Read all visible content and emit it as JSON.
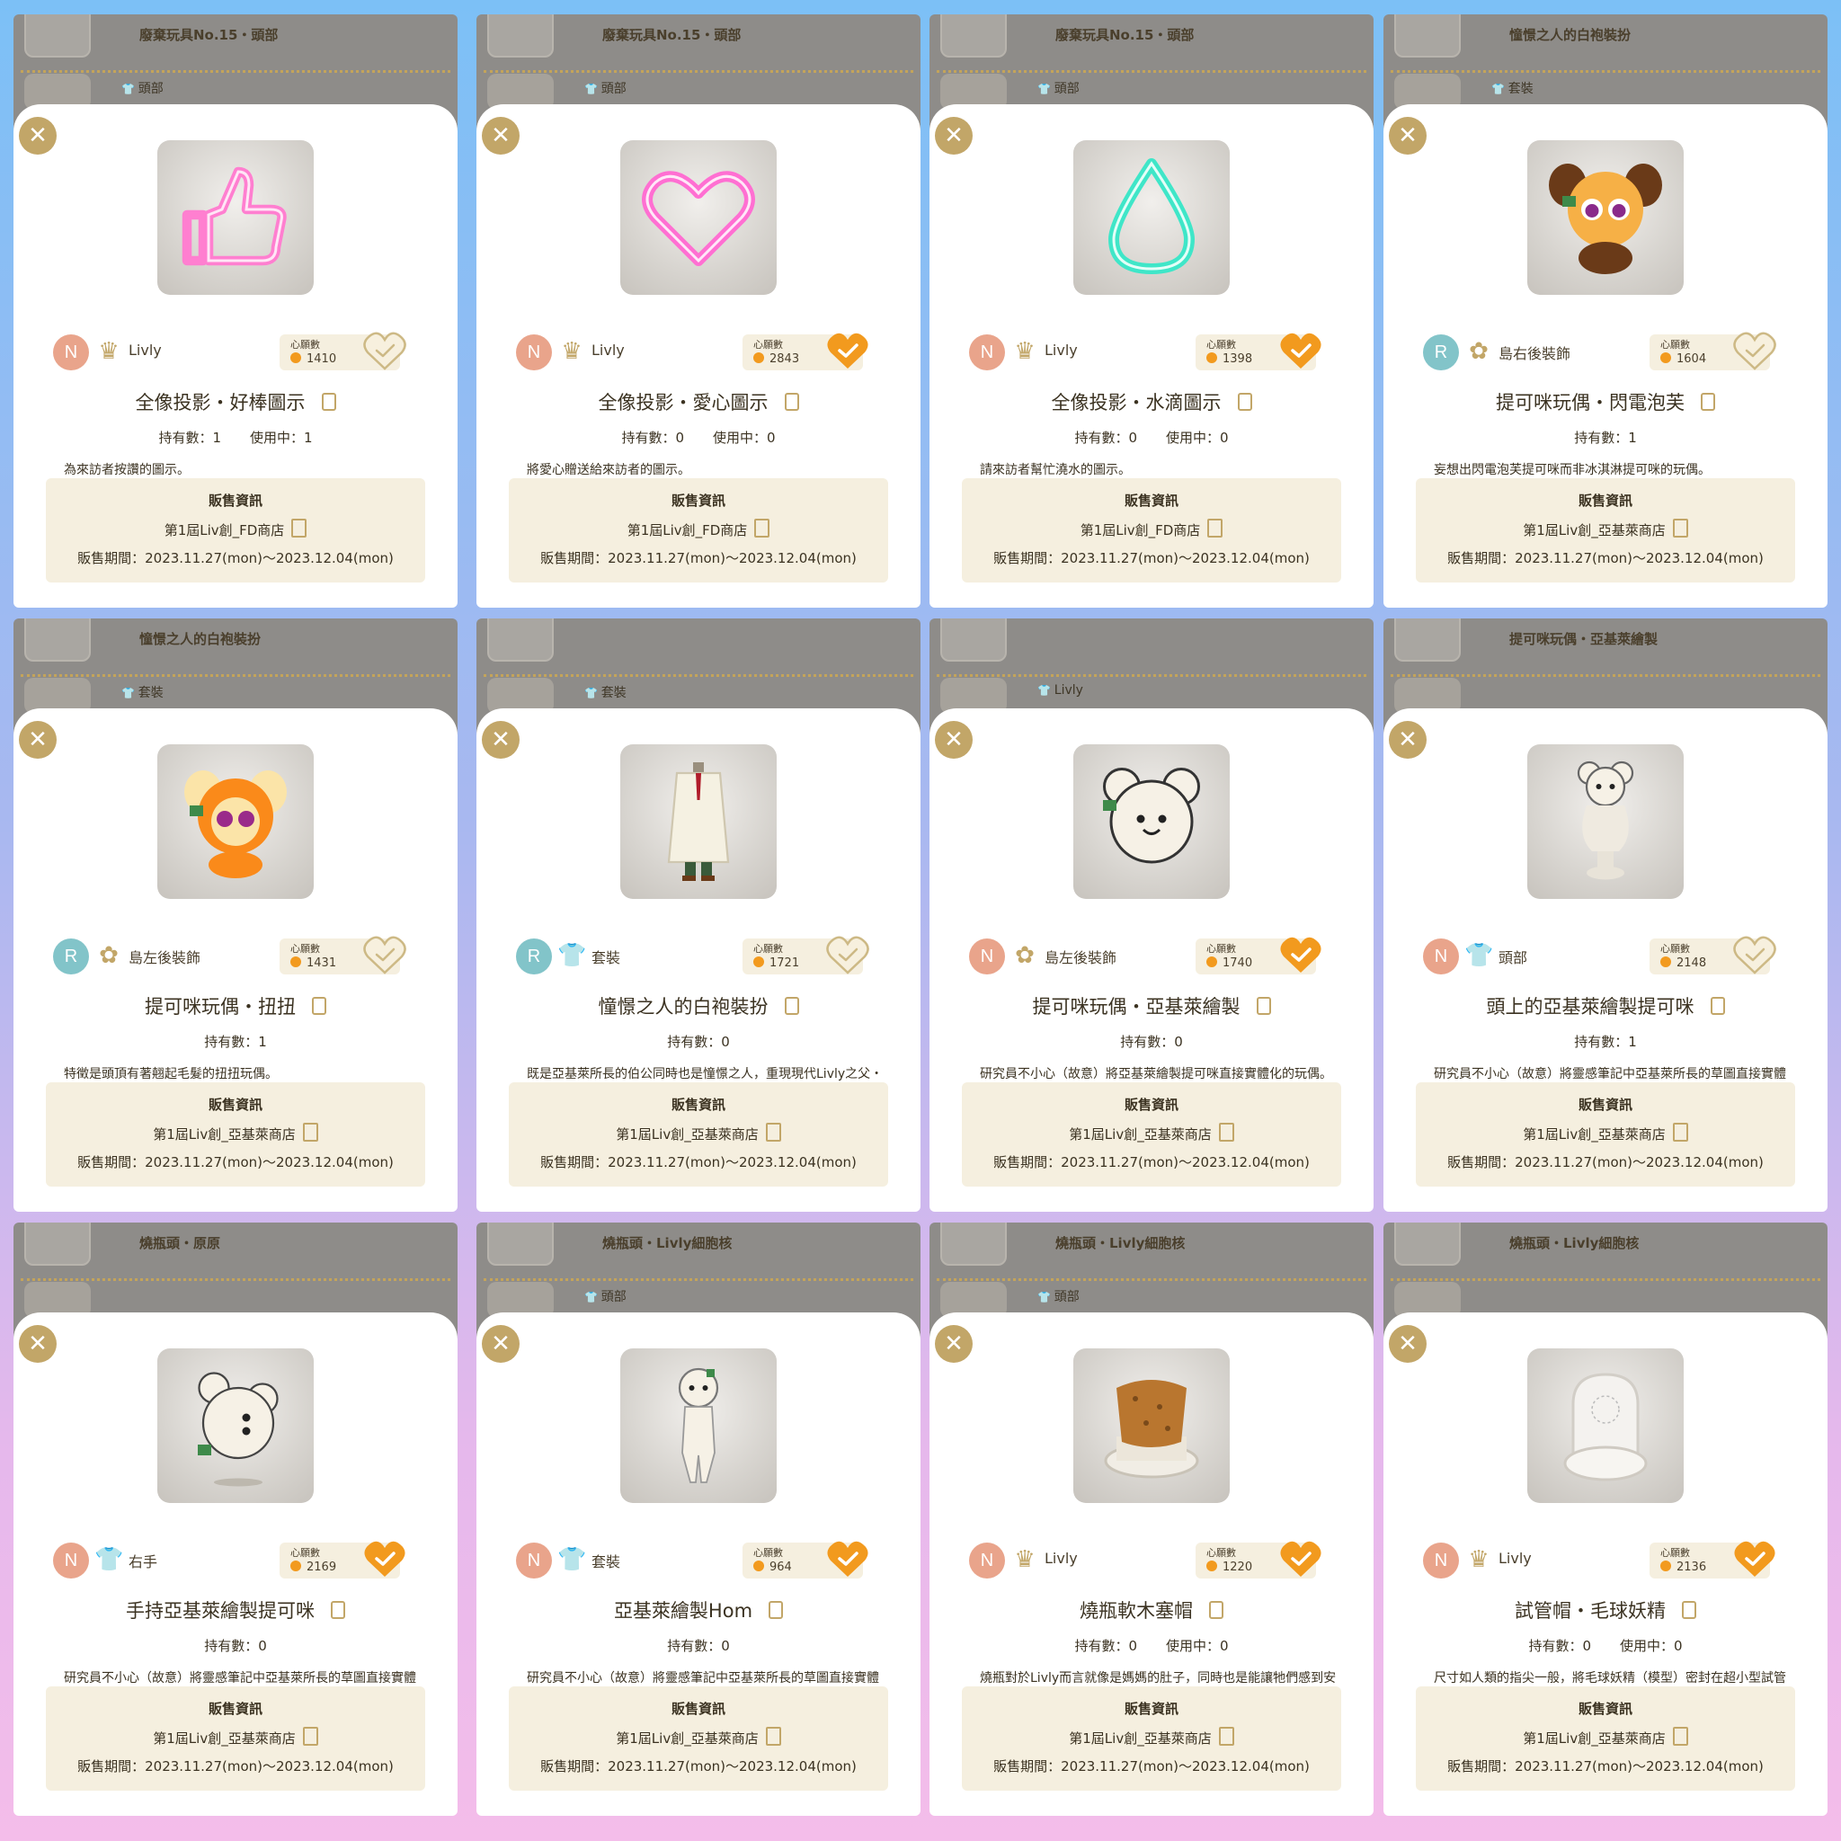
{
  "colors": {
    "accent": "#f29a1e",
    "gold": "#c2a668",
    "sale_bg": "#f5efdf"
  },
  "labels": {
    "wish": "心願數",
    "sale_title": "販售資訊",
    "owned_prefix": "持有數：",
    "using_prefix": "使用中："
  },
  "panels": [
    {
      "bg_lines": [
        "廢棄玩具No.15・頭部",
        "頭部"
      ],
      "rank": "N",
      "category_icon": "crown-icon",
      "category": "Livly",
      "wish_count": "1410",
      "wished": false,
      "name": "全像投影・好棒圖示",
      "owned": "持有數：1",
      "using": "使用中：1",
      "desc": "為來訪者按讚的圖示。",
      "shop": "第1屆Liv創_FD商店",
      "period": "販售期間：2023.11.27(mon)〜2023.12.04(mon)",
      "art": "thumb-icon"
    },
    {
      "bg_lines": [
        "廢棄玩具No.15・頭部",
        "頭部"
      ],
      "rank": "N",
      "category_icon": "crown-icon",
      "category": "Livly",
      "wish_count": "2843",
      "wished": true,
      "name": "全像投影・愛心圖示",
      "owned": "持有數：0",
      "using": "使用中：0",
      "desc": "將愛心贈送給來訪者的圖示。",
      "shop": "第1屆Liv創_FD商店",
      "period": "販售期間：2023.11.27(mon)〜2023.12.04(mon)",
      "art": "heart-icon"
    },
    {
      "bg_lines": [
        "廢棄玩具No.15・頭部",
        "頭部"
      ],
      "rank": "N",
      "category_icon": "crown-icon",
      "category": "Livly",
      "wish_count": "1398",
      "wished": true,
      "name": "全像投影・水滴圖示",
      "owned": "持有數：0",
      "using": "使用中：0",
      "desc": "請來訪者幫忙澆水的圖示。",
      "shop": "第1屆Liv創_FD商店",
      "period": "販售期間：2023.11.27(mon)〜2023.12.04(mon)",
      "art": "drop-icon"
    },
    {
      "bg_lines": [
        "憧憬之人的白袍裝扮",
        "套裝"
      ],
      "rank": "R",
      "category_icon": "ornament-icon",
      "category": "島右後裝飾",
      "wish_count": "1604",
      "wished": false,
      "name": "提可咪玩偶・閃電泡芙",
      "owned": "持有數：1",
      "using": "",
      "desc": "妄想出閃電泡芙提可咪而非冰淇淋提可咪的玩偶。",
      "shop": "第1屆Liv創_亞基萊商店",
      "period": "販售期間：2023.11.27(mon)〜2023.12.04(mon)",
      "art": "plush-orange-icon"
    },
    {
      "bg_lines": [
        "憧憬之人的白袍裝扮",
        "套裝"
      ],
      "rank": "R",
      "category_icon": "ornament-icon",
      "category": "島左後裝飾",
      "wish_count": "1431",
      "wished": false,
      "name": "提可咪玩偶・扭扭",
      "owned": "持有數：1",
      "using": "",
      "desc": "特徵是頭頂有著翹起毛髮的扭扭玩偶。",
      "shop": "第1屆Liv創_亞基萊商店",
      "period": "販售期間：2023.11.27(mon)〜2023.12.04(mon)",
      "art": "plush-twist-icon"
    },
    {
      "bg_lines": [
        "",
        "套裝"
      ],
      "rank": "R",
      "category_icon": "shirt-icon",
      "category": "套裝",
      "wish_count": "1721",
      "wished": false,
      "name": "憧憬之人的白袍裝扮",
      "owned": "持有數：0",
      "using": "",
      "desc": "既是亞基萊所長的伯公同時也是憧憬之人，重現現代Livly之父・穆拉博士的白袍裝扮。",
      "shop": "第1屆Liv創_亞基萊商店",
      "period": "販售期間：2023.11.27(mon)〜2023.12.04(mon)",
      "art": "coat-icon"
    },
    {
      "bg_lines": [
        "",
        "Livly"
      ],
      "rank": "N",
      "category_icon": "ornament-icon",
      "category": "島左後裝飾",
      "wish_count": "1740",
      "wished": true,
      "name": "提可咪玩偶・亞基萊繪製",
      "owned": "持有數：0",
      "using": "",
      "desc": "研究員不小心（故意）將亞基萊繪製提可咪直接實體化的玩偶。",
      "shop": "第1屆Liv創_亞基萊商店",
      "period": "販售期間：2023.11.27(mon)〜2023.12.04(mon)",
      "art": "plush-white-icon"
    },
    {
      "bg_lines": [
        "提可咪玩偶・亞基萊繪製",
        ""
      ],
      "rank": "N",
      "category_icon": "shirt-icon",
      "category": "頭部",
      "wish_count": "2148",
      "wished": false,
      "name": "頭上的亞基萊繪製提可咪",
      "owned": "持有數：1",
      "using": "",
      "desc": "研究員不小心（故意）將靈感筆記中亞基萊所長的草圖直接實體化的商品。",
      "shop": "第1屆Liv創_亞基萊商店",
      "period": "販售期間：2023.11.27(mon)〜2023.12.04(mon)",
      "art": "head-plush-icon"
    },
    {
      "bg_lines": [
        "燒瓶頭・原原",
        ""
      ],
      "rank": "N",
      "category_icon": "shirt-icon",
      "category": "右手",
      "wish_count": "2169",
      "wished": true,
      "name": "手持亞基萊繪製提可咪",
      "owned": "持有數：0",
      "using": "",
      "desc": "研究員不小心（故意）將靈感筆記中亞基萊所長的草圖直接實體化的商品。",
      "shop": "第1屆Liv創_亞基萊商店",
      "period": "販售期間：2023.11.27(mon)〜2023.12.04(mon)",
      "art": "hand-plush-icon"
    },
    {
      "bg_lines": [
        "燒瓶頭・Livly細胞核",
        "頭部"
      ],
      "rank": "N",
      "category_icon": "shirt-icon",
      "category": "套裝",
      "wish_count": "964",
      "wished": true,
      "name": "亞基萊繪製Hom",
      "owned": "持有數：0",
      "using": "",
      "desc": "研究員不小心（故意）將靈感筆記中亞基萊所長的草圖直接實體化的商品。",
      "shop": "第1屆Liv創_亞基萊商店",
      "period": "販售期間：2023.11.27(mon)〜2023.12.04(mon)",
      "art": "hom-icon"
    },
    {
      "bg_lines": [
        "燒瓶頭・Livly細胞核",
        "頭部"
      ],
      "rank": "N",
      "category_icon": "crown-icon",
      "category": "Livly",
      "wish_count": "1220",
      "wished": true,
      "name": "燒瓶軟木塞帽",
      "owned": "持有數：0",
      "using": "使用中：0",
      "desc": "燒瓶對於Livly而言就像是媽媽的肚子，同時也是能讓牠們感到安心的場所。使用燒瓶瓶口與軟木塞製作的帽子。",
      "shop": "第1屆Liv創_亞基萊商店",
      "period": "販售期間：2023.11.27(mon)〜2023.12.04(mon)",
      "art": "cork-icon"
    },
    {
      "bg_lines": [
        "燒瓶頭・Livly細胞核",
        ""
      ],
      "rank": "N",
      "category_icon": "crown-icon",
      "category": "Livly",
      "wish_count": "2136",
      "wished": true,
      "name": "試管帽・毛球妖精",
      "owned": "持有數：0",
      "using": "使用中：0",
      "desc": "尺寸如人類的指尖一般，將毛球妖精（模型）密封在超小型試管中的帽子。",
      "shop": "第1屆Liv創_亞基萊商店",
      "period": "販售期間：2023.11.27(mon)〜2023.12.04(mon)",
      "art": "tube-icon"
    }
  ]
}
